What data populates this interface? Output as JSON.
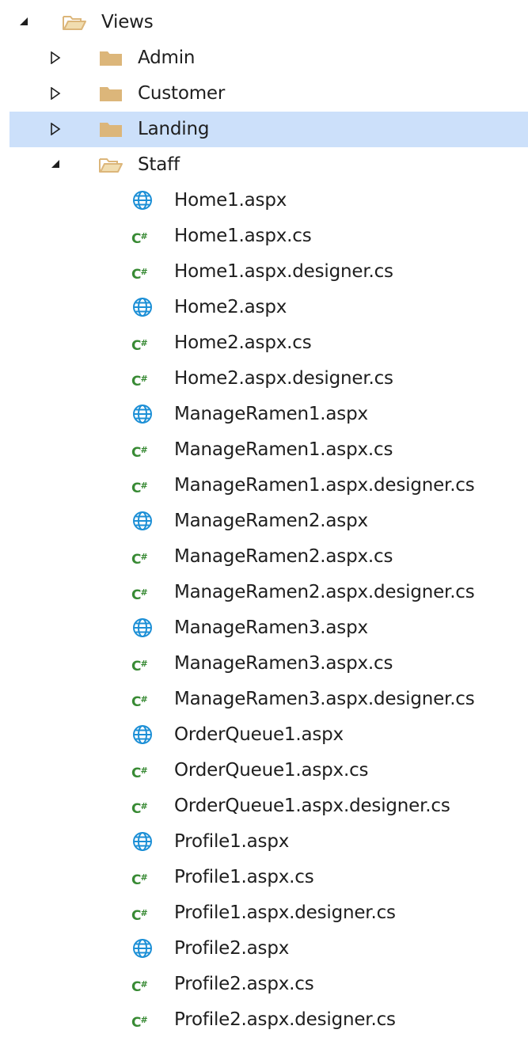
{
  "explorer": {
    "colors": {
      "selected_row": "#cce0fa",
      "folder": "#dcb67a",
      "csharp": "#388a34",
      "web": "#1c8fd6"
    },
    "rows": [
      {
        "label": "Views",
        "type": "folder",
        "state": "expanded",
        "depth": 0
      },
      {
        "label": "Admin",
        "type": "folder",
        "state": "collapsed",
        "depth": 1
      },
      {
        "label": "Customer",
        "type": "folder",
        "state": "collapsed",
        "depth": 1
      },
      {
        "label": "Landing",
        "type": "folder",
        "state": "collapsed",
        "depth": 1,
        "selected": true
      },
      {
        "label": "Staff",
        "type": "folder",
        "state": "expanded",
        "depth": 1
      },
      {
        "label": "Home1.aspx",
        "type": "web",
        "depth": 2
      },
      {
        "label": "Home1.aspx.cs",
        "type": "cs",
        "depth": 2
      },
      {
        "label": "Home1.aspx.designer.cs",
        "type": "cs",
        "depth": 2
      },
      {
        "label": "Home2.aspx",
        "type": "web",
        "depth": 2
      },
      {
        "label": "Home2.aspx.cs",
        "type": "cs",
        "depth": 2
      },
      {
        "label": "Home2.aspx.designer.cs",
        "type": "cs",
        "depth": 2
      },
      {
        "label": "ManageRamen1.aspx",
        "type": "web",
        "depth": 2
      },
      {
        "label": "ManageRamen1.aspx.cs",
        "type": "cs",
        "depth": 2
      },
      {
        "label": "ManageRamen1.aspx.designer.cs",
        "type": "cs",
        "depth": 2
      },
      {
        "label": "ManageRamen2.aspx",
        "type": "web",
        "depth": 2
      },
      {
        "label": "ManageRamen2.aspx.cs",
        "type": "cs",
        "depth": 2
      },
      {
        "label": "ManageRamen2.aspx.designer.cs",
        "type": "cs",
        "depth": 2
      },
      {
        "label": "ManageRamen3.aspx",
        "type": "web",
        "depth": 2
      },
      {
        "label": "ManageRamen3.aspx.cs",
        "type": "cs",
        "depth": 2
      },
      {
        "label": "ManageRamen3.aspx.designer.cs",
        "type": "cs",
        "depth": 2
      },
      {
        "label": "OrderQueue1.aspx",
        "type": "web",
        "depth": 2
      },
      {
        "label": "OrderQueue1.aspx.cs",
        "type": "cs",
        "depth": 2
      },
      {
        "label": "OrderQueue1.aspx.designer.cs",
        "type": "cs",
        "depth": 2
      },
      {
        "label": "Profile1.aspx",
        "type": "web",
        "depth": 2
      },
      {
        "label": "Profile1.aspx.cs",
        "type": "cs",
        "depth": 2
      },
      {
        "label": "Profile1.aspx.designer.cs",
        "type": "cs",
        "depth": 2
      },
      {
        "label": "Profile2.aspx",
        "type": "web",
        "depth": 2
      },
      {
        "label": "Profile2.aspx.cs",
        "type": "cs",
        "depth": 2
      },
      {
        "label": "Profile2.aspx.designer.cs",
        "type": "cs",
        "depth": 2
      }
    ]
  }
}
